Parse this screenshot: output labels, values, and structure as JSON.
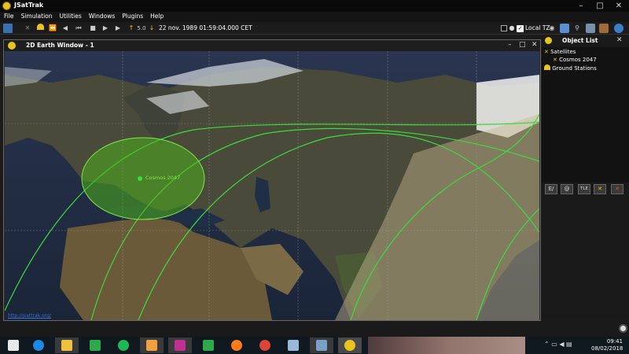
{
  "window": {
    "title": "JSatTrak",
    "minimize_icon": "–",
    "maximize_icon": "□",
    "close_icon": "✕"
  },
  "menu": {
    "items": [
      "File",
      "Simulation",
      "Utilities",
      "Windows",
      "Plugins",
      "Help"
    ]
  },
  "toolbar": {
    "step_size": "5.0",
    "datetime": "22 nov. 1989 01:59:04.000 CET",
    "local_tz_label": "Local TZ"
  },
  "earth_window": {
    "title": "2D Earth Window - 1",
    "satellite_label": "Cosmos 2047",
    "footer_link": "http://jsattrak.org/"
  },
  "object_list": {
    "title": "Object List",
    "satellites_label": "Satellites",
    "satellite_item": "Cosmos 2047",
    "ground_stations_label": "Ground Stations",
    "buttons": [
      "E/",
      "@",
      "TLE",
      "✕",
      "✕"
    ]
  },
  "taskbar": {
    "time": "09:41",
    "date": "08/02/2018"
  },
  "colors": {
    "track": "#3cdc3c",
    "footprint": "#4caf1c",
    "accent": "#e8c420"
  }
}
